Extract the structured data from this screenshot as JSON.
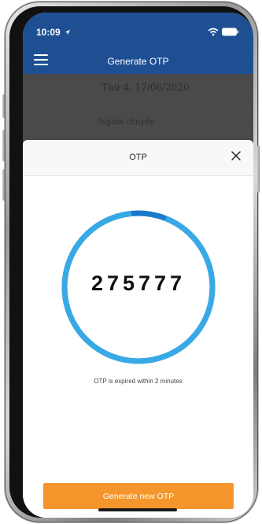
{
  "status_bar": {
    "time": "10:09"
  },
  "header": {
    "title": "Generate OTP",
    "menu_icon": "hamburger-menu-icon"
  },
  "background_content": {
    "date_line": "Thứ 4, 17/06/2020",
    "sender_label": "Người chuyển"
  },
  "modal": {
    "title": "OTP",
    "close_icon": "close-icon",
    "otp_code": "275777",
    "timer_progress": 0.06,
    "expire_text": "OTP is expired within 2 minutes",
    "generate_button": "Generate new OTP"
  },
  "colors": {
    "header": "#1f4f93",
    "ring_main": "#1a7fd0",
    "ring_light": "#39a9e6",
    "ring_dark": "#1b4d8e",
    "button": "#f4962c"
  }
}
